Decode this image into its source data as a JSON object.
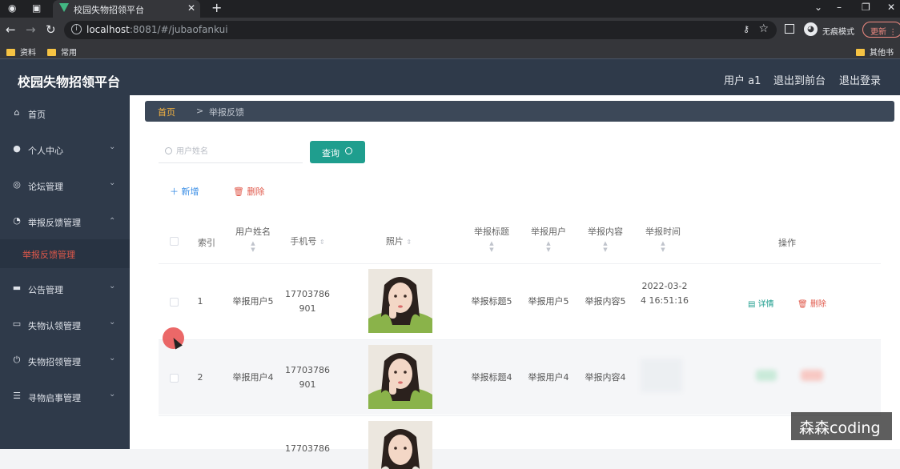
{
  "browser": {
    "tab_title": "校园失物招领平台",
    "url_host": "localhost",
    "url_rest": ":8081/#/jubaofankui",
    "incognito_label": "无痕模式",
    "update_label": "更新",
    "bookmarks": [
      "资料",
      "常用"
    ],
    "other_bookmarks": "其他书签"
  },
  "header": {
    "title": "校园失物招领平台",
    "user": "用户 a1",
    "to_front": "退出到前台",
    "logout": "退出登录"
  },
  "sidebar": {
    "items": [
      {
        "label": "首页",
        "icon": "home-icon",
        "glyph": "⌂"
      },
      {
        "label": "个人中心",
        "icon": "user-icon",
        "glyph": "●"
      },
      {
        "label": "论坛管理",
        "icon": "compass-icon",
        "glyph": "◎"
      },
      {
        "label": "举报反馈管理",
        "icon": "gauge-icon",
        "glyph": "◔"
      },
      {
        "label": "公告管理",
        "icon": "monitor-icon",
        "glyph": "▬"
      },
      {
        "label": "失物认领管理",
        "icon": "chat-icon",
        "glyph": "▭"
      },
      {
        "label": "失物招领管理",
        "icon": "power-icon",
        "glyph": "⏻"
      },
      {
        "label": "寻物启事管理",
        "icon": "list-icon",
        "glyph": "☰"
      }
    ],
    "active_sub": "举报反馈管理"
  },
  "breadcrumb": {
    "home": "首页",
    "separator": ">",
    "current": "举报反馈"
  },
  "search": {
    "placeholder": "用户姓名",
    "button": "查询"
  },
  "actions": {
    "add": "新增",
    "delete": "删除"
  },
  "table": {
    "headers": {
      "index": "索引",
      "name": "用户姓名",
      "phone": "手机号",
      "photo": "照片",
      "title": "举报标题",
      "user": "举报用户",
      "content": "举报内容",
      "time": "举报时间",
      "ops": "操作"
    },
    "rows": [
      {
        "index": "1",
        "name": "举报用户5",
        "phone": "17703786901",
        "title": "举报标题5",
        "user": "举报用户5",
        "content": "举报内容5",
        "time": "2022-03-24 16:51:16",
        "detail": "详情",
        "delete": "删除"
      },
      {
        "index": "2",
        "name": "举报用户4",
        "phone": "17703786901",
        "title": "举报标题4",
        "user": "举报用户4",
        "content": "举报内容4",
        "time": "",
        "detail": "",
        "delete": ""
      },
      {
        "index": "",
        "name": "",
        "phone": "17703786",
        "title": "",
        "user": "",
        "content": "",
        "time": "",
        "detail": "",
        "delete": ""
      }
    ]
  },
  "watermark": "森森coding",
  "colors": {
    "sidebar_bg": "#2f3a4a",
    "accent": "#1f9e8e",
    "danger": "#e0584a",
    "breadcrumb_home": "#f5b341"
  }
}
